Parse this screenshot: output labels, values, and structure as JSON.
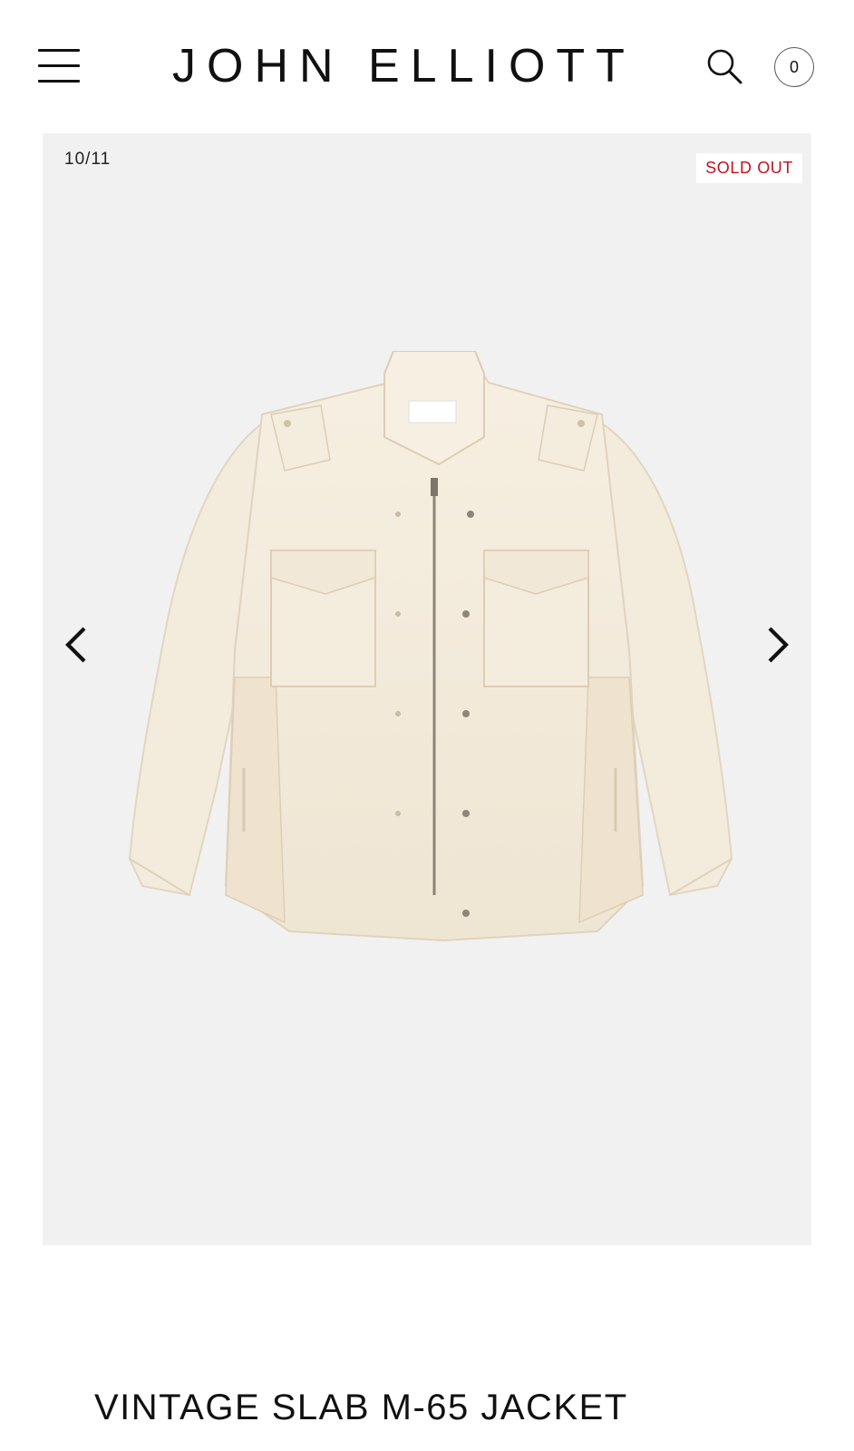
{
  "header": {
    "brand": "JOHN ELLIOTT",
    "cart_count": "0",
    "menu_icon": "hamburger-menu-icon",
    "search_icon": "search-icon"
  },
  "gallery": {
    "counter": "10/11",
    "badge": "SOLD OUT",
    "prev_icon": "chevron-left-icon",
    "next_icon": "chevron-right-icon",
    "image_alt": "jacket-image"
  },
  "product": {
    "title": "VINTAGE SLAB M-65 JACKET"
  },
  "colors": {
    "badge_text": "#c1121f",
    "gallery_bg": "#f1f1f1",
    "jacket": "#f4ecdc"
  }
}
